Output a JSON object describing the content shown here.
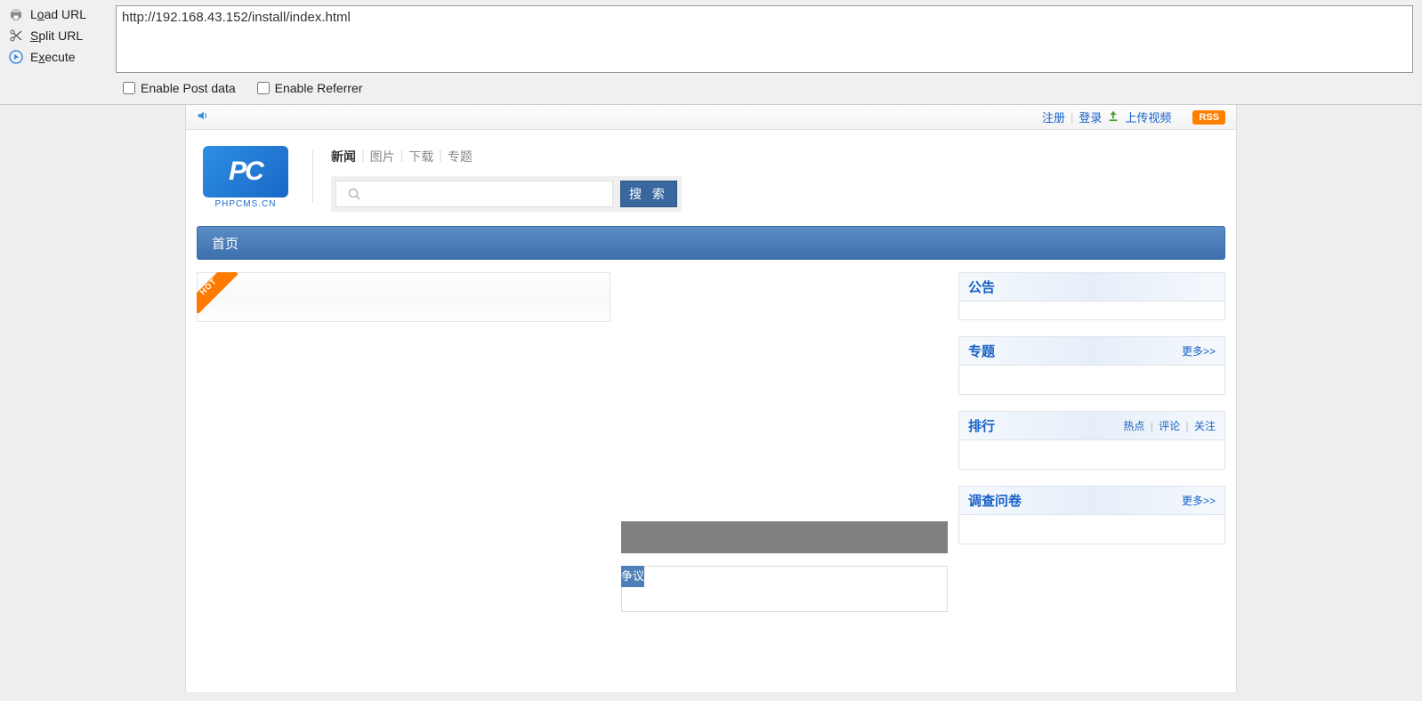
{
  "toolbar": {
    "load_url": "Load URL",
    "split_url": "Split URL",
    "execute": "Execute",
    "url_value": "http://192.168.43.152/install/index.html",
    "enable_post": "Enable Post data",
    "enable_referrer": "Enable Referrer"
  },
  "topbar": {
    "register": "注册",
    "login": "登录",
    "upload_video": "上传视频",
    "rss": "RSS"
  },
  "logo": {
    "mark": "PC",
    "sub": "PHPCMS.CN"
  },
  "tabs": {
    "items": [
      "新闻",
      "图片",
      "下载",
      "专题"
    ]
  },
  "search": {
    "placeholder": "",
    "button": "搜 索"
  },
  "nav": {
    "home": "首页"
  },
  "hot": {
    "ribbon": "HOT"
  },
  "mid": {
    "tag": "争议"
  },
  "sidebar": {
    "announcement": {
      "title": "公告"
    },
    "special": {
      "title": "专题",
      "more": "更多>>"
    },
    "ranking": {
      "title": "排行",
      "links": [
        "热点",
        "评论",
        "关注"
      ]
    },
    "survey": {
      "title": "调查问卷",
      "more": "更多>>"
    }
  }
}
